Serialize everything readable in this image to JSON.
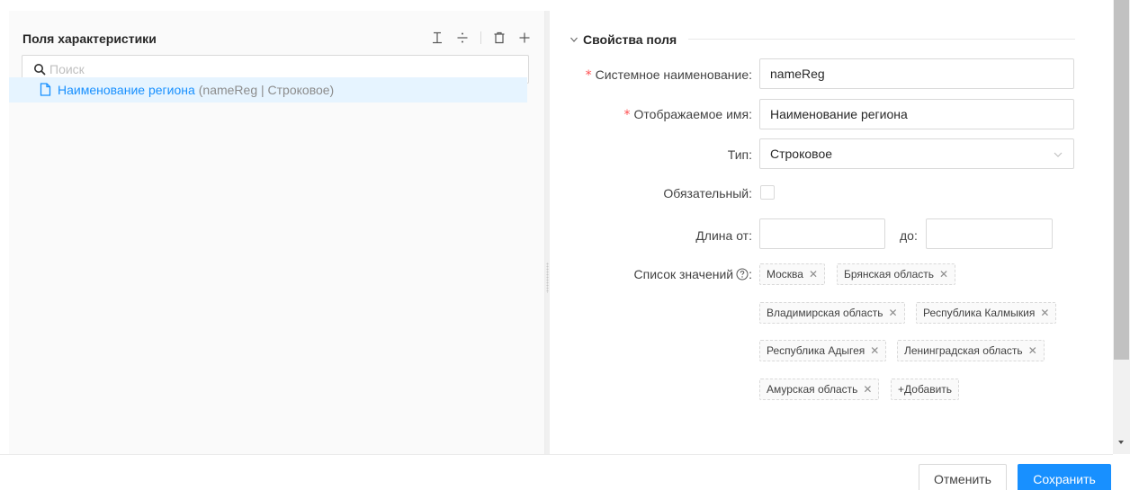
{
  "left_panel": {
    "title": "Поля характеристики",
    "tools": [
      "collapse-all-icon",
      "split-icon",
      "delete-icon",
      "add-icon"
    ],
    "search_placeholder": "Поиск",
    "tree_items": [
      {
        "name": "Наименование региона",
        "meta": "(nameReg | Строковое)"
      }
    ]
  },
  "form": {
    "section_title": "Свойства поля",
    "system_name_label": "Системное наименование",
    "system_name_value": "nameReg",
    "display_name_label": "Отображаемое имя",
    "display_name_value": "Наименование региона",
    "type_label": "Тип",
    "type_value": "Строковое",
    "required_label": "Обязательный",
    "required_checked": false,
    "length_from_label": "Длина от",
    "length_to_label": "до",
    "length_from_value": "",
    "length_to_value": "",
    "values_label": "Список значений",
    "values": [
      "Москва",
      "Брянская область",
      "Владимирская область",
      "Республика Калмыкия",
      "Республика Адыгея",
      "Ленинградская область",
      "Амурская область"
    ],
    "add_tag_label": "+Добавить",
    "colon": ":"
  },
  "footer": {
    "cancel_label": "Отменить",
    "save_label": "Сохранить"
  },
  "colors": {
    "primary": "#1890ff",
    "required": "#ff4d4f",
    "selected_row": "#e6f4ff"
  }
}
